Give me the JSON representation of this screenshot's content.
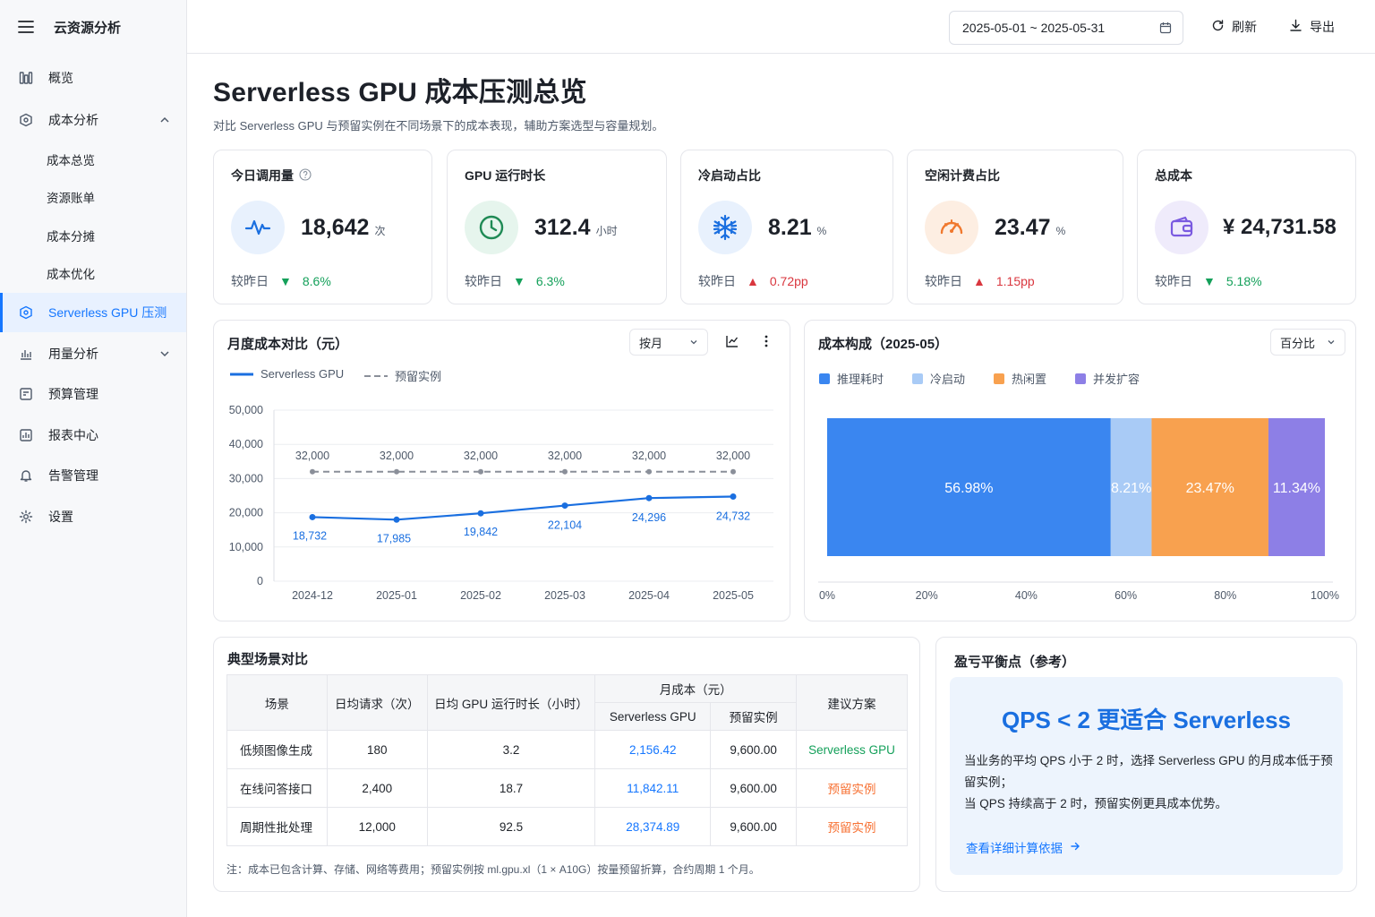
{
  "app": {
    "title": "云资源分析"
  },
  "sidebar": {
    "items": [
      {
        "label": "概览"
      },
      {
        "label": "成本分析"
      },
      {
        "label": "成本总览"
      },
      {
        "label": "资源账单"
      },
      {
        "label": "成本分摊"
      },
      {
        "label": "成本优化"
      },
      {
        "label": "Serverless GPU 压测"
      },
      {
        "label": "用量分析"
      },
      {
        "label": "预算管理"
      },
      {
        "label": "报表中心"
      },
      {
        "label": "告警管理"
      },
      {
        "label": "设置"
      }
    ]
  },
  "topbar": {
    "date_range": "2025-05-01 ~ 2025-05-31",
    "refresh_label": "刷新",
    "export_label": "导出"
  },
  "page": {
    "title": "Serverless GPU 成本压测总览",
    "subtitle": "对比 Serverless GPU 与预留实例在不同场景下的成本表现，辅助方案选型与容量规划。"
  },
  "kpis": [
    {
      "label": "今日调用量",
      "value": "18,642",
      "unit": "次",
      "cmp_label": "较昨日",
      "delta": "8.6%",
      "direction": "down",
      "icon": "pulse-icon"
    },
    {
      "label": "GPU 运行时长",
      "value": "312.4",
      "unit": "小时",
      "cmp_label": "较昨日",
      "delta": "6.3%",
      "direction": "down",
      "icon": "clock-icon"
    },
    {
      "label": "冷启动占比",
      "value": "8.21",
      "unit": "%",
      "cmp_label": "较昨日",
      "delta": "0.72pp",
      "direction": "up",
      "icon": "snowflake-icon"
    },
    {
      "label": "空闲计费占比",
      "value": "23.47",
      "unit": "%",
      "cmp_label": "较昨日",
      "delta": "1.15pp",
      "direction": "up",
      "icon": "gauge-icon"
    },
    {
      "label": "总成本",
      "value": "¥ 24,731.58",
      "unit": "",
      "cmp_label": "较昨日",
      "delta": "5.18%",
      "direction": "down",
      "icon": "wallet-icon"
    }
  ],
  "monthly_chart": {
    "title": "月度成本对比（元）",
    "select_label": "按月"
  },
  "composition_chart": {
    "title": "成本构成（2025-05）",
    "select_label": "百分比"
  },
  "chart_data": [
    {
      "type": "line",
      "title": "月度成本对比（元）",
      "categories": [
        "2024-12",
        "2025-01",
        "2025-02",
        "2025-03",
        "2025-04",
        "2025-05"
      ],
      "series": [
        {
          "name": "Serverless GPU",
          "values": [
            18732,
            17985,
            19842,
            22104,
            24296,
            24732
          ],
          "labels": [
            "18,732",
            "17,985",
            "19,842",
            "22,104",
            "24,296",
            "24,732"
          ],
          "color": "#1a6fe0",
          "style": "solid"
        },
        {
          "name": "预留实例",
          "values": [
            32000,
            32000,
            32000,
            32000,
            32000,
            32000
          ],
          "labels": [
            "32,000",
            "32,000",
            "32,000",
            "32,000",
            "32,000",
            "32,000"
          ],
          "color": "#8a8f99",
          "style": "dashed"
        }
      ],
      "ylim": [
        0,
        50000
      ],
      "yticks": [
        "0",
        "10,000",
        "20,000",
        "30,000",
        "40,000",
        "50,000"
      ],
      "grid": true,
      "legend": "top-left"
    },
    {
      "type": "bar",
      "orientation": "horizontal-stacked",
      "title": "成本构成（2025-05）",
      "segments": [
        {
          "name": "推理耗时",
          "value": 56.98,
          "label": "56.98%",
          "color": "#3a86f0"
        },
        {
          "name": "冷启动",
          "value": 8.21,
          "label": "8.21%",
          "color": "#a9cbf6"
        },
        {
          "name": "热闲置",
          "value": 23.47,
          "label": "23.47%",
          "color": "#f8a14f"
        },
        {
          "name": "并发扩容",
          "value": 11.34,
          "label": "11.34%",
          "color": "#8d7fe6"
        }
      ],
      "xlim": [
        0,
        100
      ],
      "xticks": [
        "0%",
        "20%",
        "40%",
        "60%",
        "80%",
        "100%"
      ],
      "legend": "top-left"
    }
  ],
  "scenario_table": {
    "title": "典型场景对比",
    "headers": {
      "scene": "场景",
      "daily_req": "日均请求（次）",
      "gpu_hours": "日均 GPU 运行时长（小时）",
      "monthly_cost": "月成本（元）",
      "serverless": "Serverless GPU",
      "reserved": "预留实例",
      "advice": "建议方案"
    },
    "rows": [
      {
        "scene": "低频图像生成",
        "daily_req": "180",
        "gpu_hours": "3.2",
        "serverless": "2,156.42",
        "reserved": "9,600.00",
        "advice": "Serverless GPU",
        "advice_type": "serverless"
      },
      {
        "scene": "在线问答接口",
        "daily_req": "2,400",
        "gpu_hours": "18.7",
        "serverless": "11,842.11",
        "reserved": "9,600.00",
        "advice": "预留实例",
        "advice_type": "reserved"
      },
      {
        "scene": "周期性批处理",
        "daily_req": "12,000",
        "gpu_hours": "92.5",
        "serverless": "28,374.89",
        "reserved": "9,600.00",
        "advice": "预留实例",
        "advice_type": "reserved"
      }
    ],
    "note": "注：成本已包含计算、存储、网络等费用；预留实例按 ml.gpu.xl（1 × A10G）按量预留折算，合约周期 1 个月。"
  },
  "breakeven": {
    "title": "盈亏平衡点（参考）",
    "headline": "QPS < 2 更适合 Serverless",
    "line1": "当业务的平均 QPS 小于 2 时，选择 Serverless GPU 的月成本低于预留实例；",
    "line2": "当 QPS 持续高于 2 时，预留实例更具成本优势。",
    "link": "查看详细计算依据"
  },
  "colors": {
    "accent": "#1677ff",
    "down": "#14a05a",
    "up": "#d9363e",
    "reserved_advice": "#f77234"
  }
}
